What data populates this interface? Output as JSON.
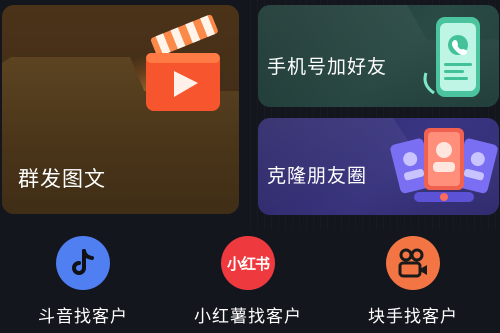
{
  "cards": {
    "group_send": {
      "label": "群发图文",
      "icon": "clapperboard-play-icon"
    },
    "phone_add": {
      "label": "手机号加好友",
      "icon": "phone-call-icon"
    },
    "moments": {
      "label": "克隆朋友圈",
      "icon": "contact-cards-icon"
    }
  },
  "shortcuts": [
    {
      "label": "斗音找客户",
      "icon": "douyin-note-icon",
      "color": "#4f7ff1"
    },
    {
      "label": "小红薯找客户",
      "icon": "xiaohongshu-logo-icon",
      "icon_text": "小红书",
      "color": "#ee3a3f"
    },
    {
      "label": "块手找客户",
      "icon": "kuaishou-camera-icon",
      "color": "#f37544"
    }
  ],
  "colors": {
    "background": "#14161d",
    "group_send_card": "#4a3519",
    "phone_card": "#2a4a45",
    "moments_card": "#3a3582"
  }
}
